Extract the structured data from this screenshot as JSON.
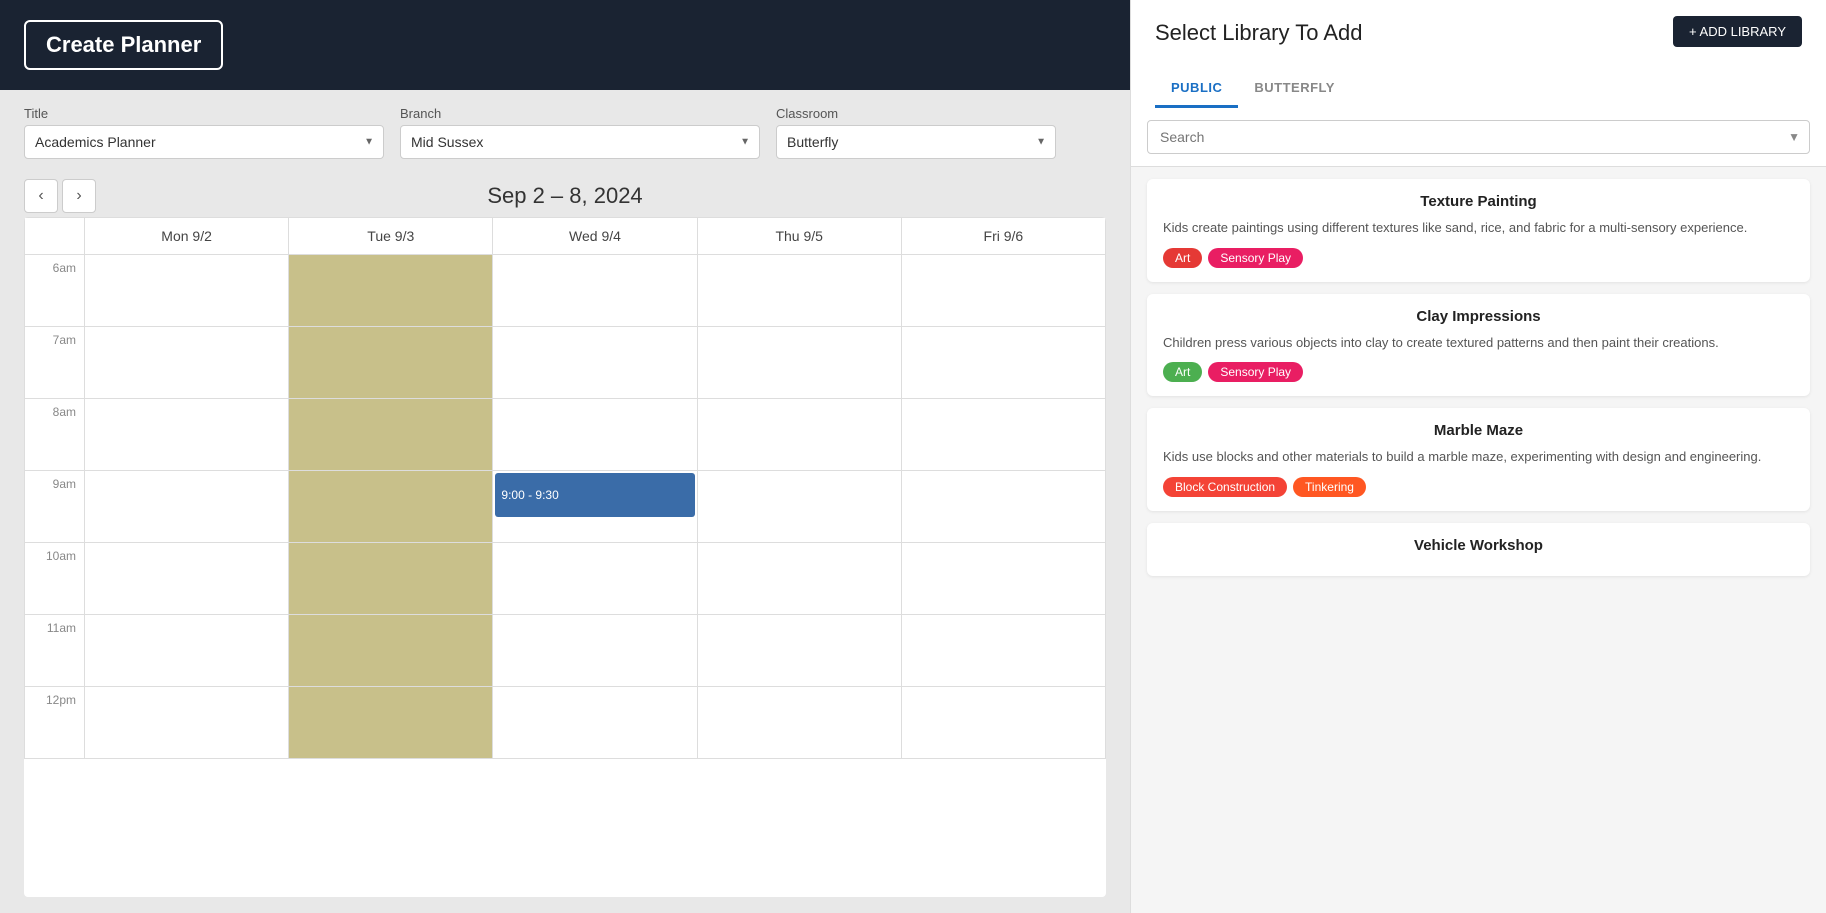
{
  "planner": {
    "create_button": "Create Planner",
    "form": {
      "title_label": "Title",
      "title_value": "Academics Planner",
      "branch_label": "Branch",
      "branch_value": "Mid Sussex",
      "classroom_label": "Classroom",
      "classroom_value": "Butterfly"
    },
    "week_range": "Sep 2 – 8, 2024",
    "days": [
      {
        "label": "Mon 9/2"
      },
      {
        "label": "Tue 9/3"
      },
      {
        "label": "Wed 9/4"
      },
      {
        "label": "Thu 9/5"
      },
      {
        "label": "Fri 9/6"
      }
    ],
    "time_slots": [
      "6am",
      "7am",
      "8am",
      "9am",
      "10am",
      "11am",
      "12pm"
    ],
    "events": [
      {
        "day": 2,
        "time_slot": 3,
        "label": "9:00 - 9:30"
      }
    ]
  },
  "library": {
    "title": "Select Library To Add",
    "add_button": "+ ADD LIBRARY",
    "tabs": [
      {
        "label": "PUBLIC",
        "active": true
      },
      {
        "label": "BUTTERFLY",
        "active": false
      }
    ],
    "search_placeholder": "Search",
    "items": [
      {
        "title": "Texture Painting",
        "desc": "Kids create paintings using different textures like sand, rice, and fabric for a multi-sensory experience.",
        "tags": [
          {
            "label": "Art",
            "type": "art"
          },
          {
            "label": "Sensory Play",
            "type": "sensory"
          }
        ]
      },
      {
        "title": "Clay Impressions",
        "desc": "Children press various objects into clay to create textured patterns and then paint their creations.",
        "tags": [
          {
            "label": "Art",
            "type": "green"
          },
          {
            "label": "Sensory Play",
            "type": "sensory"
          }
        ]
      },
      {
        "title": "Marble Maze",
        "desc": "Kids use blocks and other materials to build a marble maze, experimenting with design and engineering.",
        "tags": [
          {
            "label": "Block Construction",
            "type": "block"
          },
          {
            "label": "Tinkering",
            "type": "tinkering"
          }
        ]
      },
      {
        "title": "Vehicle Workshop",
        "desc": "",
        "tags": []
      }
    ]
  }
}
